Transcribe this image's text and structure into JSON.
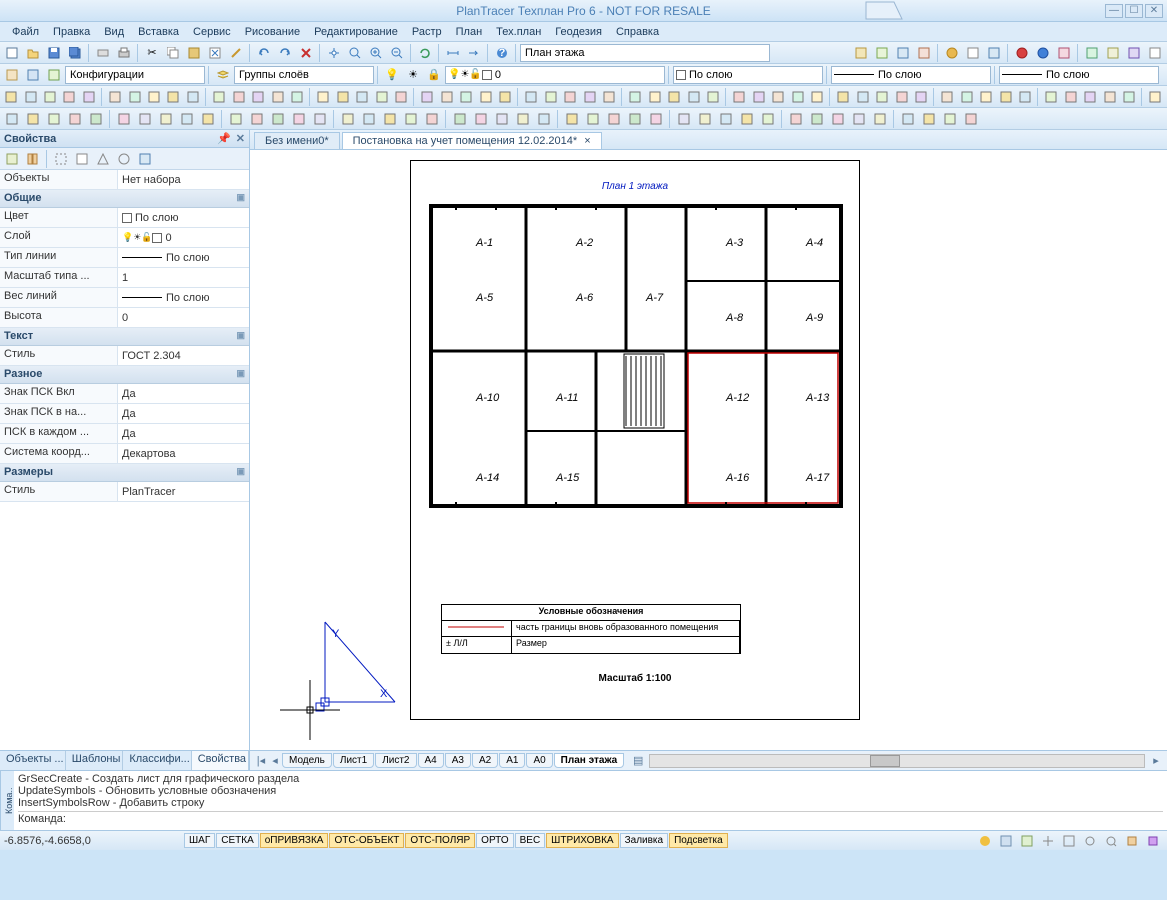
{
  "title": "PlanTracer Техплан Pro 6 - NOT FOR RESALE",
  "menu": [
    "Файл",
    "Правка",
    "Вид",
    "Вставка",
    "Сервис",
    "Рисование",
    "Редактирование",
    "Растр",
    "План",
    "Тех.план",
    "Геодезия",
    "Справка"
  ],
  "toolbar1": {
    "plan_field": "План этажа"
  },
  "toolbar2": {
    "config": "Конфигурации",
    "layers": "Группы слоёв",
    "layer_val": "0",
    "color": "По слою",
    "line": "По слою",
    "line2": "По слою"
  },
  "doc_tabs": [
    {
      "label": "Без имени0*",
      "active": false
    },
    {
      "label": "Постановка на учет помещения 12.02.2014*",
      "active": true
    }
  ],
  "props": {
    "panel_title": "Свойства",
    "rows_top": [
      {
        "l": "Объекты",
        "v": "Нет набора"
      }
    ],
    "sec1": "Общие",
    "rows1": [
      {
        "l": "Цвет",
        "v": "По слою",
        "sw": true
      },
      {
        "l": "Слой",
        "v": "0",
        "layer": true
      },
      {
        "l": "Тип линии",
        "v": "По слою",
        "line": true
      },
      {
        "l": "Масштаб типа ...",
        "v": "1"
      },
      {
        "l": "Вес линий",
        "v": "По слою",
        "line": true
      },
      {
        "l": "Высота",
        "v": "0"
      }
    ],
    "sec2": "Текст",
    "rows2": [
      {
        "l": "Стиль",
        "v": "ГОСТ 2.304"
      }
    ],
    "sec3": "Разное",
    "rows3": [
      {
        "l": "Знак ПСК Вкл",
        "v": "Да"
      },
      {
        "l": "Знак ПСК в на...",
        "v": "Да"
      },
      {
        "l": "ПСК в каждом ...",
        "v": "Да"
      },
      {
        "l": "Система коорд...",
        "v": "Декартова"
      }
    ],
    "sec4": "Размеры",
    "rows4": [
      {
        "l": "Стиль",
        "v": "PlanTracer"
      }
    ],
    "tabs": [
      "Объекты ...",
      "Шаблоны",
      "Классифи...",
      "Свойства"
    ]
  },
  "drawing": {
    "plan_title": "План 1 этажа",
    "legend_title": "Условные обозначения",
    "legend_rows": [
      {
        "sym": "",
        "txt": "часть границы вновь образованного помещения"
      },
      {
        "sym": "± Л/Л",
        "txt": "Размер"
      }
    ],
    "scale": "Масштаб 1:100",
    "axis_x": "X",
    "axis_y": "Y"
  },
  "layout_tabs": [
    "Модель",
    "Лист1",
    "Лист2",
    "A4",
    "A3",
    "A2",
    "A1",
    "A0",
    "План этажа"
  ],
  "cmd": {
    "lines": [
      "GrSecCreate - Создать лист для графического раздела",
      "UpdateSymbols - Обновить условные обозначения",
      "InsertSymbolsRow - Добавить строку"
    ],
    "prompt": "Команда:",
    "side": "Кома.."
  },
  "status": {
    "coord": "-6.8576,-4.6658,0",
    "toggles": [
      {
        "t": "ШАГ",
        "on": false
      },
      {
        "t": "СЕТКА",
        "on": false
      },
      {
        "t": "оПРИВЯЗКА",
        "on": true
      },
      {
        "t": "ОТС-ОБЪЕКТ",
        "on": true
      },
      {
        "t": "ОТС-ПОЛЯР",
        "on": true
      },
      {
        "t": "ОРТО",
        "on": false
      },
      {
        "t": "ВЕС",
        "on": false
      },
      {
        "t": "ШТРИХОВКА",
        "on": true
      },
      {
        "t": "Заливка",
        "on": false
      },
      {
        "t": "Подсветка",
        "on": true
      }
    ]
  }
}
